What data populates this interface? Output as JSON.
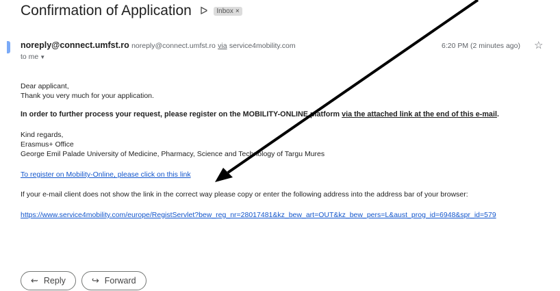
{
  "subject": "Confirmation of Application",
  "label": "Inbox",
  "sender": {
    "name": "noreply@connect.umfst.ro",
    "email": "noreply@connect.umfst.ro",
    "via": "via",
    "via_domain": "service4mobility.com",
    "to": "to me"
  },
  "time": "6:20 PM (2 minutes ago)",
  "body": {
    "greeting": "Dear applicant,",
    "thanks": "Thank you very much for your application.",
    "instruction": "In order to further process your request, please register on the MOBILITY-ONLINE platform",
    "instruction_link": "via the attached link at the end of this e-mail",
    "instruction_end": ".",
    "regards": "Kind regards,",
    "office": "Erasmus+ Office",
    "university": "George Emil Palade University of Medicine, Pharmacy, Science and Technology of Targu Mures",
    "register_link": "To register on Mobility-Online, please click on this link",
    "fallback": "If your e-mail client does not show the link in the correct way please copy or enter the following address into the address bar of your browser:",
    "url": "https://www.service4mobility.com/europe/RegistServlet?bew_reg_nr=28017481&kz_bew_art=OUT&kz_bew_pers=L&aust_prog_id=6948&spr_id=579"
  },
  "buttons": {
    "reply": "Reply",
    "forward": "Forward"
  },
  "icons": {
    "important": "importance-marker-icon",
    "star": "star-icon",
    "reply": "reply-icon",
    "forward": "forward-icon"
  }
}
